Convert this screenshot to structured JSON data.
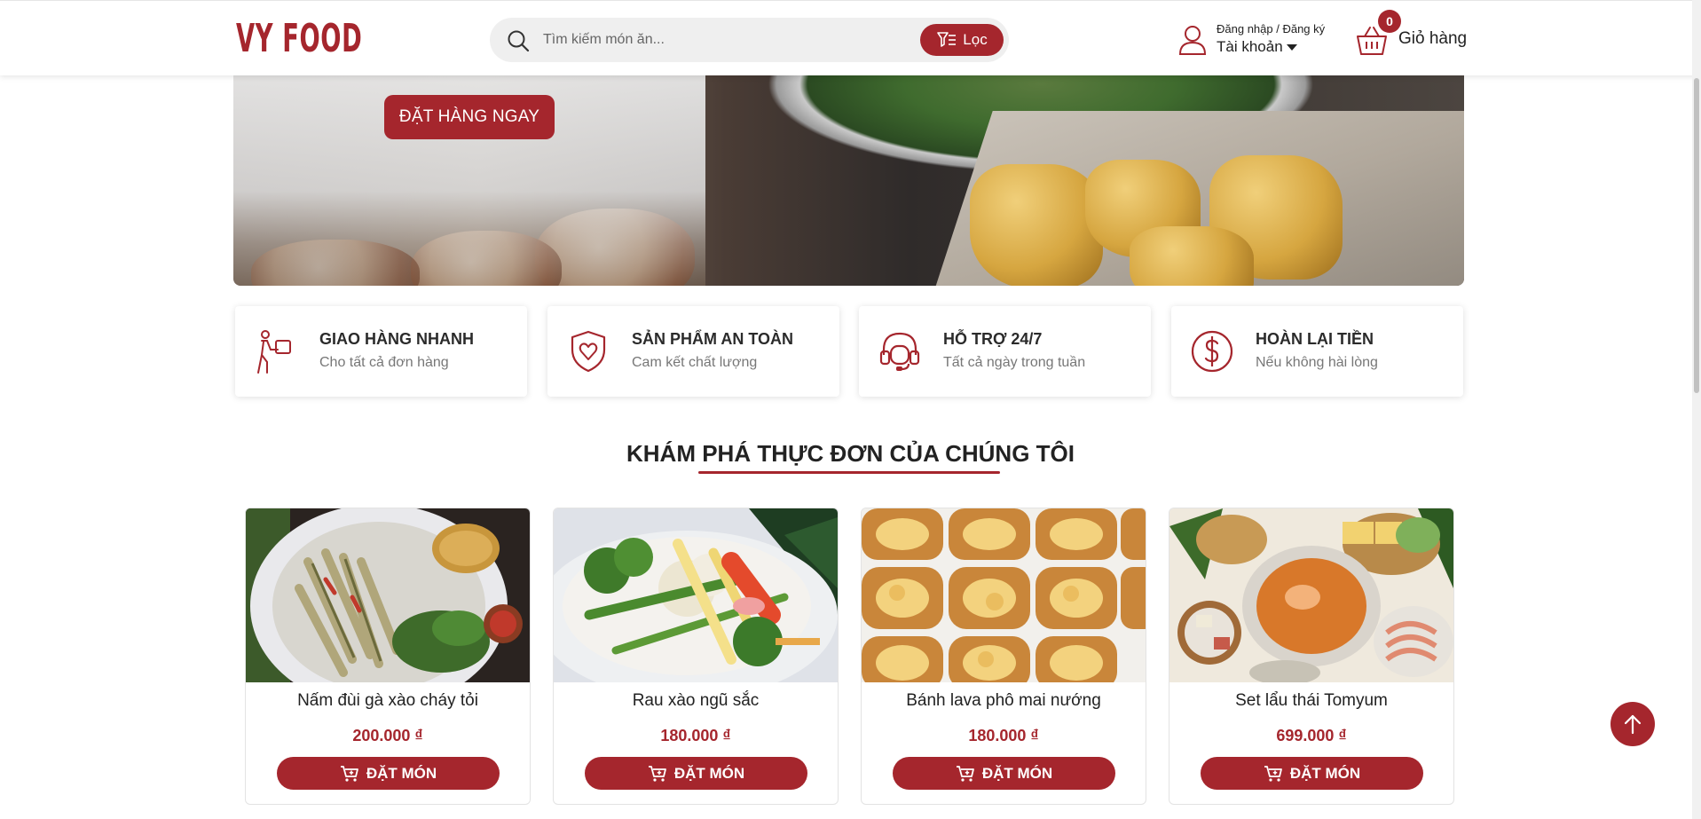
{
  "header": {
    "brand": "VY FOOD",
    "search_placeholder": "Tìm kiếm món ăn...",
    "filter_label": "Lọc",
    "account_small": "Đăng nhập / Đăng ký",
    "account_main": "Tài khoản",
    "cart_count": "0",
    "cart_label": "Giỏ hàng"
  },
  "banner": {
    "cta_label": "ĐẶT HÀNG NGAY"
  },
  "features": [
    {
      "icon": "delivery-icon",
      "title": "GIAO HÀNG NHANH",
      "subtitle": "Cho tất cả đơn hàng"
    },
    {
      "icon": "shield-heart-icon",
      "title": "SẢN PHẨM AN TOÀN",
      "subtitle": "Cam kết chất lượng"
    },
    {
      "icon": "headset-icon",
      "title": "HỖ TRỢ 24/7",
      "subtitle": "Tất cả ngày trong tuần"
    },
    {
      "icon": "dollar-icon",
      "title": "HOÀN LẠI TIỀN",
      "subtitle": "Nếu không hài lòng"
    }
  ],
  "menu": {
    "title": "KHÁM PHÁ THỰC ĐƠN CỦA CHÚNG TÔI",
    "order_label": "ĐẶT MÓN",
    "products": [
      {
        "name": "Nấm đùi gà xào cháy tỏi",
        "price": "200.000 ₫"
      },
      {
        "name": "Rau xào ngũ sắc",
        "price": "180.000 ₫"
      },
      {
        "name": "Bánh lava phô mai nướng",
        "price": "180.000 ₫"
      },
      {
        "name": "Set lẩu thái Tomyum",
        "price": "699.000 ₫"
      }
    ]
  },
  "colors": {
    "accent": "#a5262d",
    "card_border": "#e3e3e3",
    "muted_text": "#777777"
  }
}
